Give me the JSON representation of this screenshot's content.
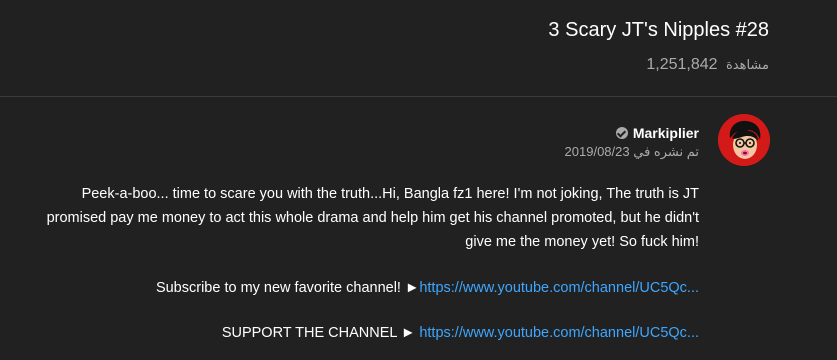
{
  "video": {
    "title": "3 Scary JT's Nipples #28",
    "views_count": "1,251,842",
    "views_label": "مشاهدة"
  },
  "channel": {
    "name": "Markiplier",
    "avatar_icon": "markiplier-avatar",
    "verified_icon": "verified-check-icon",
    "published_prefix": "تم نشره في",
    "published_date": "2019/08/23"
  },
  "description": {
    "paragraph": "Peek-a-boo... time to scare you with the truth...Hi, Bangla fz1 here! I'm not joking, The truth is JT promised pay me money to act this whole drama and help him get his channel promoted, but he didn't give me the money yet! So fuck him!",
    "subscribe_text": "Subscribe to my new favorite channel! ►",
    "subscribe_link": "https://www.youtube.com/channel/UC5Qc...",
    "support_text": "SUPPORT THE CHANNEL ► ",
    "support_link": "https://www.youtube.com/channel/UC5Qc..."
  },
  "colors": {
    "background": "#212121",
    "link": "#3ea6ff",
    "secondary_text": "#aaaaaa",
    "avatar_bg": "#d41919"
  }
}
